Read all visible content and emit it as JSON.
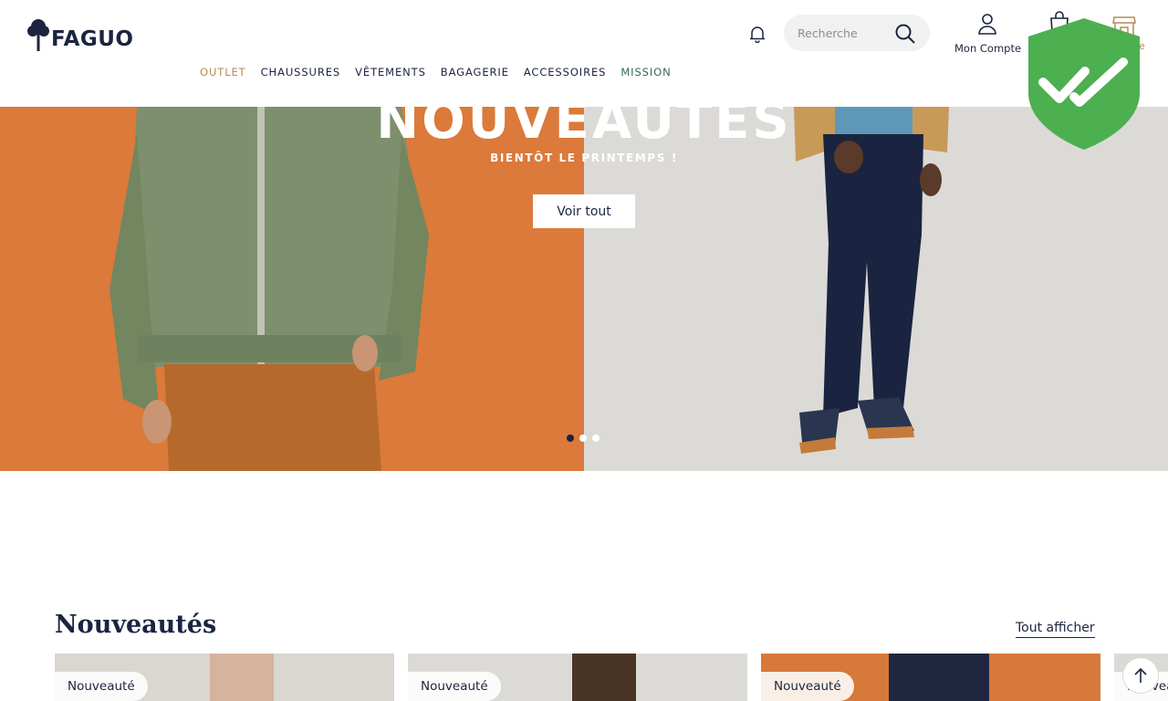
{
  "brand": {
    "name": "FAGUO"
  },
  "nav": {
    "items": [
      {
        "label": "OUTLET"
      },
      {
        "label": "CHAUSSURES"
      },
      {
        "label": "VÊTEMENTS"
      },
      {
        "label": "BAGAGERIE"
      },
      {
        "label": "ACCESSOIRES"
      },
      {
        "label": "MISSION"
      }
    ]
  },
  "header": {
    "search_placeholder": "Recherche",
    "account_label": "Mon Compte",
    "store_label_partial": "que"
  },
  "hero": {
    "title": "NOUVEAUTÉS",
    "subtitle": "BIENTÔT LE PRINTEMPS !",
    "button_label": "Voir tout",
    "slide_count": 3,
    "active_slide": 1
  },
  "section": {
    "title": "Nouveautés",
    "see_all_label": "Tout afficher"
  },
  "products": [
    {
      "badge": "Nouveauté"
    },
    {
      "badge": "Nouveauté"
    },
    {
      "badge": "Nouveauté"
    },
    {
      "badge": "Nouvea"
    }
  ],
  "colors": {
    "navy": "#1b2440",
    "outlet": "#b98a55",
    "mission": "#2f6b55",
    "hero_left": "#db7a3a",
    "hero_right": "#dcdad6",
    "shield": "#4caf50"
  },
  "icons": {
    "logo": "tree-icon",
    "bell": "bell-icon",
    "search": "search-icon",
    "account": "user-icon",
    "bag": "shopping-bag-icon",
    "store": "store-icon",
    "scroll_top": "arrow-up-icon",
    "overlay": "shield-check-icon"
  }
}
